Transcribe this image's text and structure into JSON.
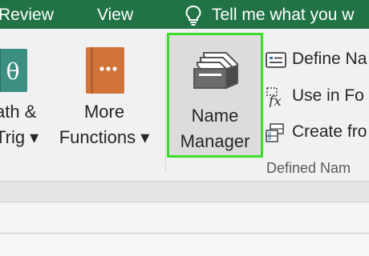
{
  "tabs": {
    "review": "Review",
    "view": "View",
    "tell_me": "Tell me what you w"
  },
  "ribbon": {
    "math_trig": {
      "line1": "ath &",
      "line2": "Trig ▾"
    },
    "more_functions": {
      "line1": "More",
      "line2": "Functions ▾"
    },
    "name_manager": {
      "line1": "Name",
      "line2": "Manager"
    },
    "define_name": "Define Na",
    "use_in_formula": "Use in Fo",
    "create_from": "Create fro",
    "group_label": "Defined Nam"
  },
  "colors": {
    "tab_bar": "#217346",
    "highlight": "#3ddc2a",
    "ribbon_bg": "#f1f1f1",
    "book_icon": "#d2743a",
    "theta_icon": "#3b8f83"
  },
  "icons": {
    "bulb": "lightbulb-icon",
    "math_trig": "theta-icon",
    "more_functions": "function-book-icon",
    "name_manager": "name-cards-icon",
    "define_name": "define-name-icon",
    "use_in_formula": "fx-icon",
    "create_from": "create-from-selection-icon"
  }
}
